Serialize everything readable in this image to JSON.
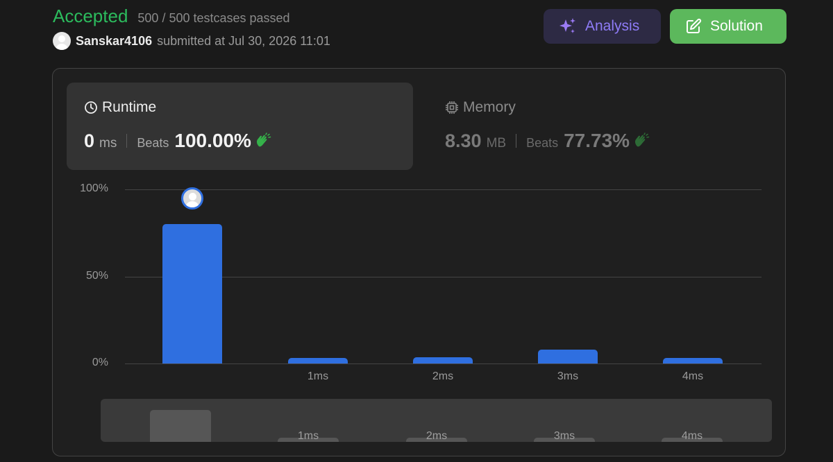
{
  "header": {
    "status": "Accepted",
    "testcases": "500 / 500 testcases passed",
    "username": "Sanskar4106",
    "submitted_at": "submitted at Jul 30, 2026 11:01"
  },
  "buttons": {
    "analysis": "Analysis",
    "solution": "Solution"
  },
  "runtime": {
    "label": "Runtime",
    "value": "0",
    "unit": "ms",
    "beats_label": "Beats",
    "beats_pct": "100.00%"
  },
  "memory": {
    "label": "Memory",
    "value": "8.30",
    "unit": "MB",
    "beats_label": "Beats",
    "beats_pct": "77.73%"
  },
  "colors": {
    "accepted": "#2cbb5d",
    "bar": "#2f6fe0",
    "analysis": "#8f7cf8",
    "solution_bg": "#5cb85c"
  },
  "icons": {
    "analysis": "sparkle-icon",
    "solution": "edit-icon",
    "runtime": "clock-icon",
    "memory": "chip-icon",
    "beats": "clap-icon"
  },
  "chart_data": {
    "type": "bar",
    "categories": [
      "",
      "1ms",
      "2ms",
      "3ms",
      "4ms"
    ],
    "values": [
      80,
      3,
      3.5,
      8,
      3
    ],
    "yticks": [
      "100%",
      "50%",
      "0%"
    ],
    "ylim": [
      0,
      100
    ],
    "highlight_index": 0
  },
  "overview": {
    "categories": [
      "",
      "1ms",
      "2ms",
      "3ms",
      "4ms"
    ]
  }
}
